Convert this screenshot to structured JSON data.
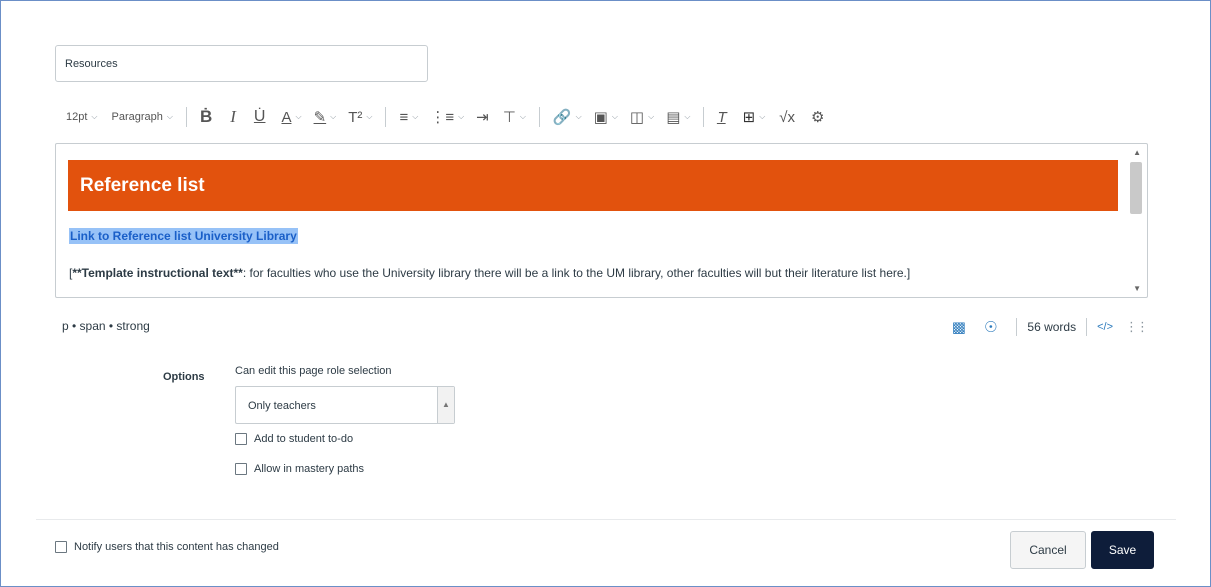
{
  "page_title_field": {
    "value": "Resources"
  },
  "toolbar": {
    "font_size": "12pt",
    "block_format": "Paragraph",
    "icons": [
      "bold-icon",
      "italic-icon",
      "underline-icon",
      "text-color-icon",
      "highlight-icon",
      "superscript-icon",
      "align-icon",
      "list-icon",
      "indent-icon",
      "clear-formatting-icon",
      "link-icon",
      "image-icon",
      "media-icon",
      "document-icon",
      "remove-format-icon",
      "table-icon",
      "equation-icon",
      "lti-tools-icon"
    ]
  },
  "editor": {
    "banner_text": "Reference list",
    "highlighted_link": "Link to Reference list University Library",
    "body_prefix": "[",
    "body_bold": "**Template instructional text**",
    "body_rest": ": for faculties who use the University library there will be a link to the UM library, other faculties will but their literature list here.]",
    "banner_color": "#e2520d"
  },
  "status_bar": {
    "path": "p • span • strong",
    "word_count": "56 words",
    "html_toggle": "</>"
  },
  "options": {
    "label": "Options",
    "role_label": "Can edit this page role selection",
    "role_selected": "Only teachers",
    "checkbox_todo": "Add to student to-do",
    "checkbox_mastery": "Allow in mastery paths"
  },
  "footer": {
    "notify_label": "Notify users that this content has changed",
    "cancel_label": "Cancel",
    "save_label": "Save"
  },
  "colors": {
    "save_button": "#0e1d3a",
    "accent_blue": "#2b7abc"
  }
}
